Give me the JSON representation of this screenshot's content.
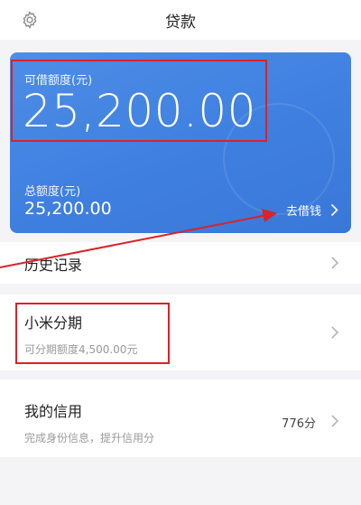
{
  "header": {
    "title": "贷款",
    "settings_icon": "gear-icon"
  },
  "loan_card": {
    "available_label": "可借额度(元)",
    "available_amount": "25,200.00",
    "total_label": "总额度(元)",
    "total_amount": "25,200.00",
    "borrow_label": "去借钱",
    "colors": {
      "card_top": "#4e8ee6",
      "card_bottom": "#3a78d8"
    }
  },
  "list": {
    "history": {
      "title": "历史记录"
    },
    "installment": {
      "title": "小米分期",
      "subtitle": "可分期额度4,500.00元"
    },
    "credit": {
      "title": "我的信用",
      "subtitle": "完成身份信息，提升信用分",
      "score": "776分"
    }
  },
  "annotation": {
    "color": "#d8232a"
  }
}
